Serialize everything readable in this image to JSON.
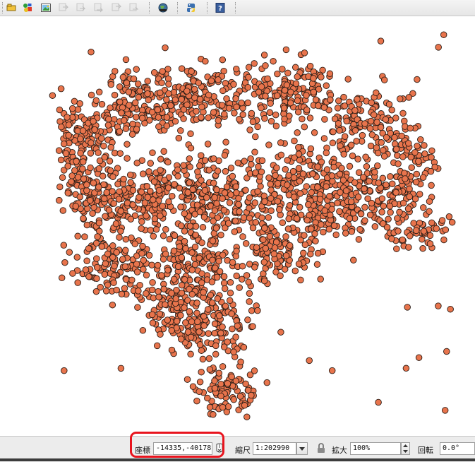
{
  "toolbar": {
    "buttons": [
      {
        "name": "open-layer-icon",
        "enabled": true
      },
      {
        "name": "symbology-icon",
        "enabled": true
      },
      {
        "name": "image-layer-icon",
        "enabled": true
      },
      {
        "name": "plugin-tool-1-icon",
        "enabled": false
      },
      {
        "name": "plugin-tool-2-icon",
        "enabled": false
      },
      {
        "name": "plugin-tool-3-icon",
        "enabled": false
      },
      {
        "name": "plugin-tool-4-icon",
        "enabled": false
      },
      {
        "name": "plugin-tool-5-icon",
        "enabled": false
      },
      {
        "name": "globe-plugin-icon",
        "enabled": true
      },
      {
        "name": "python-console-icon",
        "enabled": true
      },
      {
        "name": "help-icon",
        "enabled": true
      }
    ]
  },
  "map": {
    "layer_type": "point",
    "point_fill": "#e8744c",
    "point_stroke": "#2b1d16",
    "background": "#ffffff"
  },
  "statusbar": {
    "coordinate_label": "座標",
    "coordinate_value": "-14335,-40178",
    "scale_label": "縮尺",
    "scale_value": "1:202990",
    "magnifier_label": "拡大",
    "magnifier_value": "100%",
    "rotation_label": "回転",
    "rotation_value": "0.0°"
  },
  "colors": {
    "highlight": "#e8141e",
    "toolbar_bg": "#ececec"
  }
}
